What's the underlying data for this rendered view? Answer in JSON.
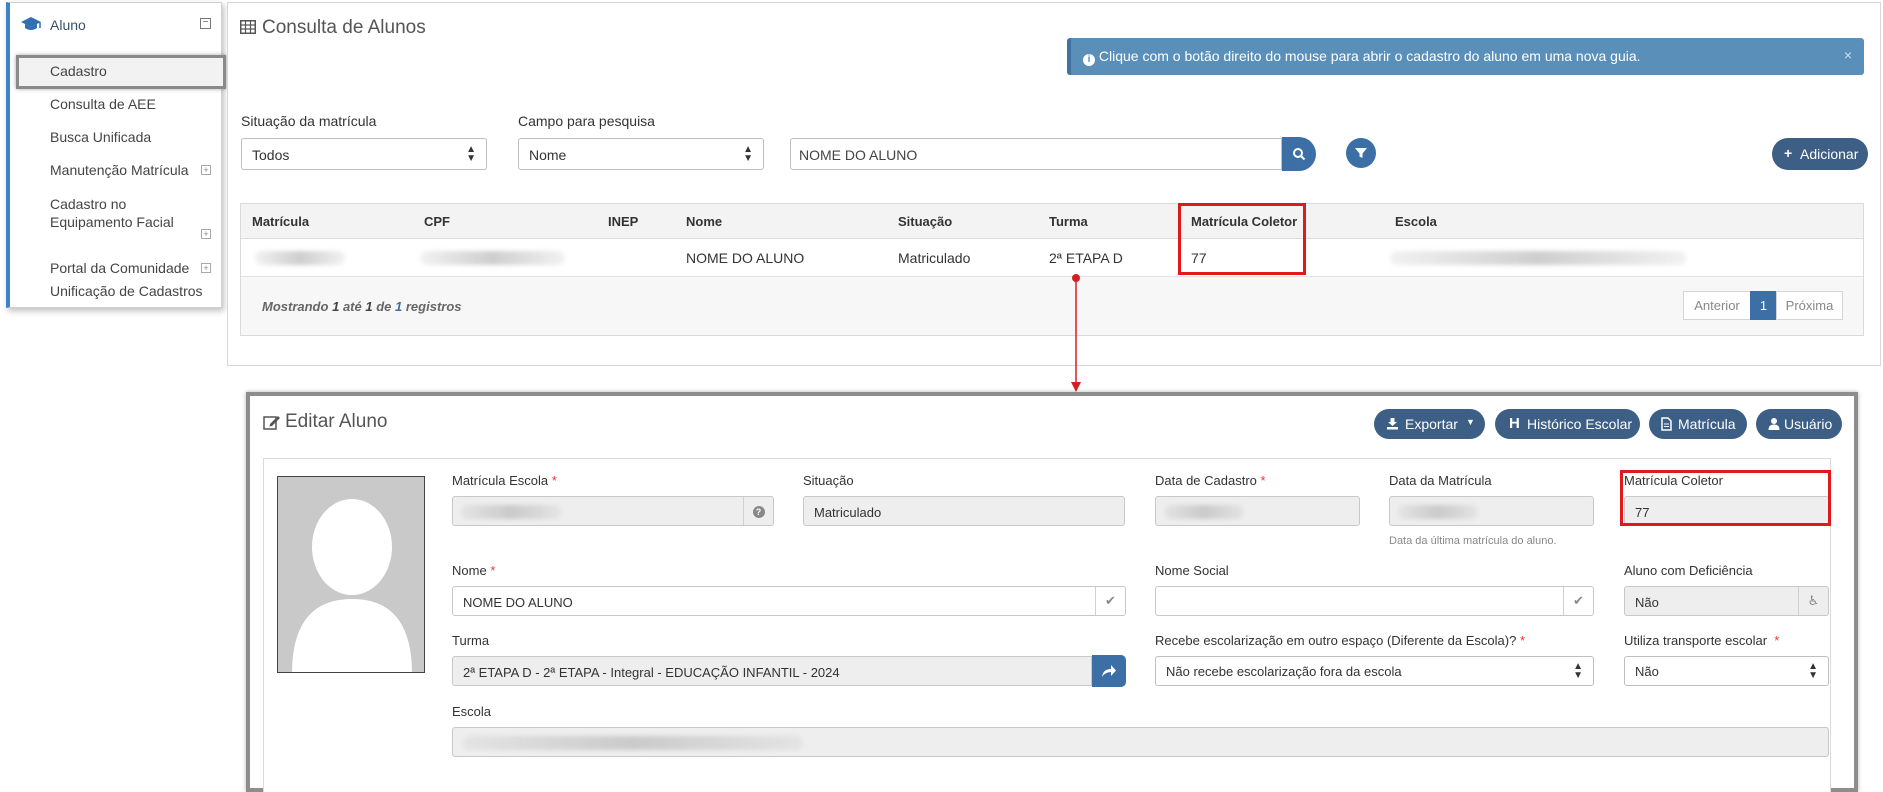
{
  "sidebar": {
    "header": "Aluno",
    "items": [
      {
        "label": "Cadastro"
      },
      {
        "label": "Consulta de AEE"
      },
      {
        "label": "Busca Unificada"
      },
      {
        "label": "Manutenção Matrícula"
      },
      {
        "label": "Cadastro no Equipamento Facial"
      },
      {
        "label": "Portal da Comunidade"
      },
      {
        "label": "Unificação de Cadastros"
      }
    ]
  },
  "consulta": {
    "title": "Consulta de Alunos",
    "alert": "Clique com o botão direito do mouse para abrir o cadastro do aluno em uma nova guia.",
    "situacao_label": "Situação da matrícula",
    "situacao_value": "Todos",
    "campo_label": "Campo para pesquisa",
    "campo_value": "Nome",
    "search_value": "NOME DO ALUNO",
    "add_label": "Adicionar",
    "columns": [
      "Matrícula",
      "CPF",
      "INEP",
      "Nome",
      "Situação",
      "Turma",
      "Matrícula Coletor",
      "Escola"
    ],
    "row": {
      "nome": "NOME DO ALUNO",
      "situacao": "Matriculado",
      "turma": "2ª ETAPA D",
      "coletor": "77"
    },
    "showing": {
      "prefix": "Mostrando",
      "from": "1",
      "ate": "até",
      "to": "1",
      "de": "de",
      "total": "1",
      "suffix": "registros"
    },
    "pager": {
      "prev": "Anterior",
      "page": "1",
      "next": "Próxima"
    }
  },
  "edit": {
    "title": "Editar Aluno",
    "buttons": {
      "exportar": "Exportar",
      "historico": "Histórico Escolar",
      "matricula": "Matrícula",
      "usuario": "Usuário"
    },
    "fields": {
      "matricula_escola": "Matrícula Escola",
      "situacao": "Situação",
      "situacao_value": "Matriculado",
      "data_cadastro": "Data de Cadastro",
      "data_matricula": "Data da Matrícula",
      "data_matricula_hint": "Data da última matrícula do aluno.",
      "matricula_coletor": "Matrícula Coletor",
      "matricula_coletor_value": "77",
      "nome": "Nome",
      "nome_value": "NOME DO ALUNO",
      "nome_social": "Nome Social",
      "deficiencia": "Aluno com Deficiência",
      "deficiencia_value": "Não",
      "turma": "Turma",
      "turma_value": "2ª ETAPA D - 2ª ETAPA - Integral - EDUCAÇÃO INFANTIL - 2024",
      "escolarizacao": "Recebe escolarização em outro espaço (Diferente da Escola)?",
      "escolarizacao_value": "Não recebe escolarização fora da escola",
      "transporte": "Utiliza transporte escolar",
      "transporte_value": "Não",
      "escola": "Escola"
    }
  },
  "colors": {
    "accent": "#3b6fa6",
    "dark_button": "#3d5e85",
    "alert": "#5a8fb9",
    "highlight": "#e01a1a"
  }
}
